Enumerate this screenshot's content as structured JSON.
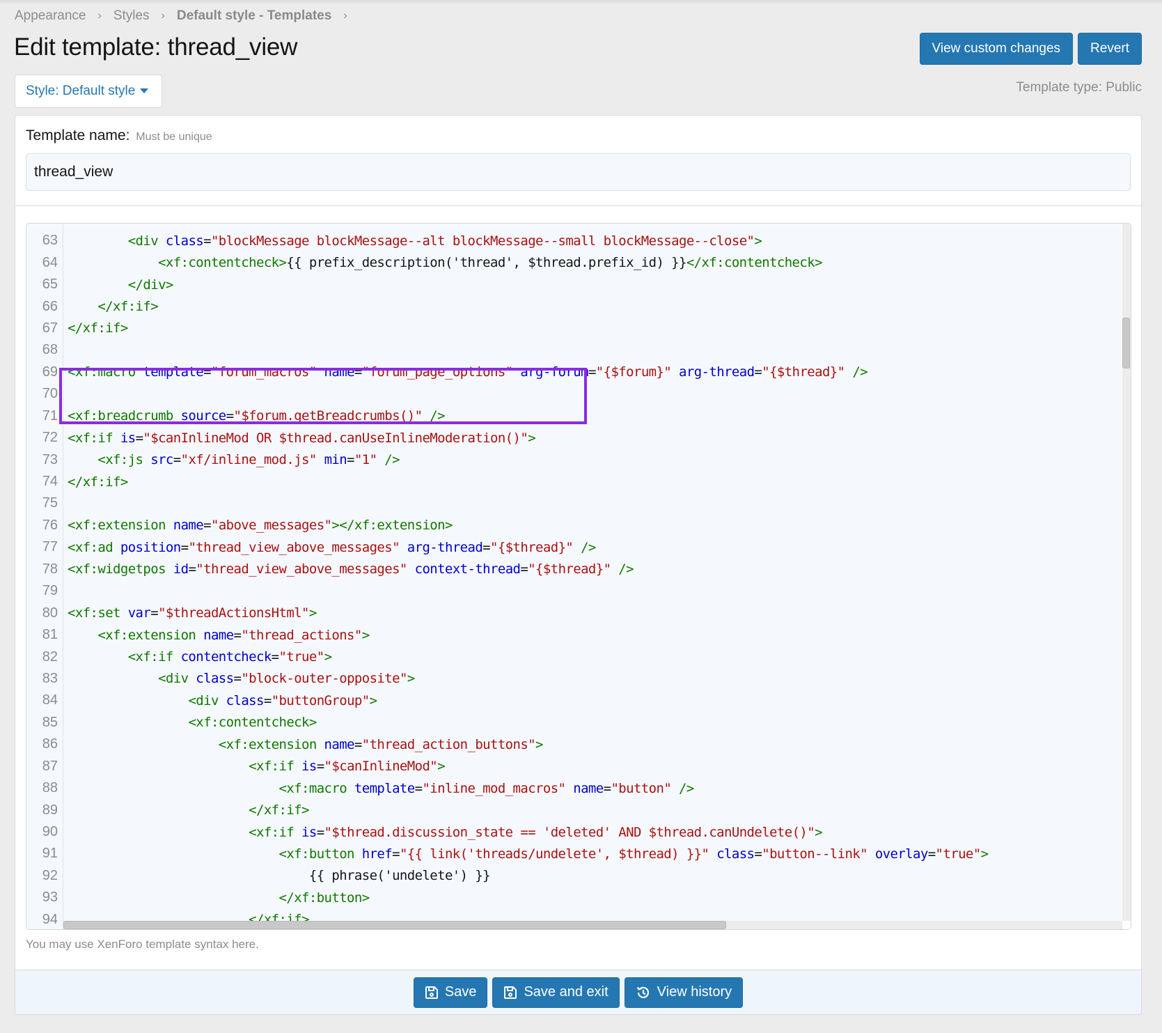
{
  "breadcrumb": {
    "items": [
      {
        "label": "Appearance"
      },
      {
        "label": "Styles"
      },
      {
        "label": "Default style - Templates"
      }
    ],
    "separator": "›"
  },
  "page": {
    "title": "Edit template: thread_view",
    "template_type": "Template type: Public"
  },
  "header_actions": {
    "view_custom_changes": "View custom changes",
    "revert": "Revert"
  },
  "style_chooser": {
    "label": "Style: Default style",
    "icon": "caret-down-icon"
  },
  "form": {
    "template_name_label": "Template name:",
    "template_name_hint": "Must be unique",
    "template_name_value": "thread_view",
    "syntax_hint": "You may use XenForo template syntax here."
  },
  "editor": {
    "highlight_color": "#8a2be2",
    "highlighted_lines": [
      70,
      71,
      72
    ],
    "vertical_scroll_position": 0.14,
    "horizontal_scroll_visible_fraction": 0.63,
    "lines": [
      {
        "n": "63",
        "indent": "        ",
        "tokens": [
          [
            "tag",
            "<div "
          ],
          [
            "attr",
            "class"
          ],
          [
            "eq",
            "="
          ],
          [
            "str",
            "\"blockMessage blockMessage--alt blockMessage--small blockMessage--close\""
          ],
          [
            "tag",
            ">"
          ]
        ]
      },
      {
        "n": "64",
        "indent": "            ",
        "tokens": [
          [
            "tag",
            "<xf:contentcheck>"
          ],
          [
            "txt",
            "{{ prefix_description('thread', $thread.prefix_id) }}"
          ],
          [
            "tag",
            "</xf:contentcheck>"
          ]
        ]
      },
      {
        "n": "65",
        "indent": "        ",
        "tokens": [
          [
            "tag",
            "</div>"
          ]
        ]
      },
      {
        "n": "66",
        "indent": "    ",
        "tokens": [
          [
            "tag",
            "</xf:if>"
          ]
        ]
      },
      {
        "n": "67",
        "indent": "",
        "tokens": [
          [
            "tag",
            "</xf:if>"
          ]
        ]
      },
      {
        "n": "68",
        "indent": "",
        "tokens": []
      },
      {
        "n": "69",
        "indent": "",
        "tokens": [
          [
            "tag",
            "<xf:macro "
          ],
          [
            "attr",
            "template"
          ],
          [
            "eq",
            "="
          ],
          [
            "str",
            "\"forum_macros\""
          ],
          [
            "txt",
            " "
          ],
          [
            "attr",
            "name"
          ],
          [
            "eq",
            "="
          ],
          [
            "str",
            "\"forum_page_options\""
          ],
          [
            "txt",
            " "
          ],
          [
            "attr",
            "arg-forum"
          ],
          [
            "eq",
            "="
          ],
          [
            "str",
            "\"{$forum}\""
          ],
          [
            "txt",
            " "
          ],
          [
            "attr",
            "arg-thread"
          ],
          [
            "eq",
            "="
          ],
          [
            "str",
            "\"{$thread}\""
          ],
          [
            "tag",
            " />"
          ]
        ]
      },
      {
        "n": "70",
        "indent": "",
        "tokens": []
      },
      {
        "n": "71",
        "indent": "",
        "tokens": [
          [
            "tag",
            "<xf:breadcrumb "
          ],
          [
            "attr",
            "source"
          ],
          [
            "eq",
            "="
          ],
          [
            "str",
            "\"$forum.getBreadcrumbs()\""
          ],
          [
            "tag",
            " />"
          ]
        ]
      },
      {
        "n": "72",
        "indent": "",
        "tokens": [
          [
            "tag",
            "<xf:if "
          ],
          [
            "attr",
            "is"
          ],
          [
            "eq",
            "="
          ],
          [
            "str",
            "\"$canInlineMod OR $thread.canUseInlineModeration()\""
          ],
          [
            "tag",
            ">"
          ]
        ]
      },
      {
        "n": "73",
        "indent": "    ",
        "tokens": [
          [
            "tag",
            "<xf:js "
          ],
          [
            "attr",
            "src"
          ],
          [
            "eq",
            "="
          ],
          [
            "str",
            "\"xf/inline_mod.js\""
          ],
          [
            "txt",
            " "
          ],
          [
            "attr",
            "min"
          ],
          [
            "eq",
            "="
          ],
          [
            "str",
            "\"1\""
          ],
          [
            "tag",
            " />"
          ]
        ]
      },
      {
        "n": "74",
        "indent": "",
        "tokens": [
          [
            "tag",
            "</xf:if>"
          ]
        ]
      },
      {
        "n": "75",
        "indent": "",
        "tokens": []
      },
      {
        "n": "76",
        "indent": "",
        "tokens": [
          [
            "tag",
            "<xf:extension "
          ],
          [
            "attr",
            "name"
          ],
          [
            "eq",
            "="
          ],
          [
            "str",
            "\"above_messages\""
          ],
          [
            "tag",
            "></xf:extension>"
          ]
        ]
      },
      {
        "n": "77",
        "indent": "",
        "tokens": [
          [
            "tag",
            "<xf:ad "
          ],
          [
            "attr",
            "position"
          ],
          [
            "eq",
            "="
          ],
          [
            "str",
            "\"thread_view_above_messages\""
          ],
          [
            "txt",
            " "
          ],
          [
            "attr",
            "arg-thread"
          ],
          [
            "eq",
            "="
          ],
          [
            "str",
            "\"{$thread}\""
          ],
          [
            "tag",
            " />"
          ]
        ]
      },
      {
        "n": "78",
        "indent": "",
        "tokens": [
          [
            "tag",
            "<xf:widgetpos "
          ],
          [
            "attr",
            "id"
          ],
          [
            "eq",
            "="
          ],
          [
            "str",
            "\"thread_view_above_messages\""
          ],
          [
            "txt",
            " "
          ],
          [
            "attr",
            "context-thread"
          ],
          [
            "eq",
            "="
          ],
          [
            "str",
            "\"{$thread}\""
          ],
          [
            "tag",
            " />"
          ]
        ]
      },
      {
        "n": "79",
        "indent": "",
        "tokens": []
      },
      {
        "n": "80",
        "indent": "",
        "tokens": [
          [
            "tag",
            "<xf:set "
          ],
          [
            "attr",
            "var"
          ],
          [
            "eq",
            "="
          ],
          [
            "str",
            "\"$threadActionsHtml\""
          ],
          [
            "tag",
            ">"
          ]
        ]
      },
      {
        "n": "81",
        "indent": "    ",
        "tokens": [
          [
            "tag",
            "<xf:extension "
          ],
          [
            "attr",
            "name"
          ],
          [
            "eq",
            "="
          ],
          [
            "str",
            "\"thread_actions\""
          ],
          [
            "tag",
            ">"
          ]
        ]
      },
      {
        "n": "82",
        "indent": "        ",
        "tokens": [
          [
            "tag",
            "<xf:if "
          ],
          [
            "attr",
            "contentcheck"
          ],
          [
            "eq",
            "="
          ],
          [
            "str",
            "\"true\""
          ],
          [
            "tag",
            ">"
          ]
        ]
      },
      {
        "n": "83",
        "indent": "            ",
        "tokens": [
          [
            "tag",
            "<div "
          ],
          [
            "attr",
            "class"
          ],
          [
            "eq",
            "="
          ],
          [
            "str",
            "\"block-outer-opposite\""
          ],
          [
            "tag",
            ">"
          ]
        ]
      },
      {
        "n": "84",
        "indent": "                ",
        "tokens": [
          [
            "tag",
            "<div "
          ],
          [
            "attr",
            "class"
          ],
          [
            "eq",
            "="
          ],
          [
            "str",
            "\"buttonGroup\""
          ],
          [
            "tag",
            ">"
          ]
        ]
      },
      {
        "n": "85",
        "indent": "                ",
        "tokens": [
          [
            "tag",
            "<xf:contentcheck>"
          ]
        ]
      },
      {
        "n": "86",
        "indent": "                    ",
        "tokens": [
          [
            "tag",
            "<xf:extension "
          ],
          [
            "attr",
            "name"
          ],
          [
            "eq",
            "="
          ],
          [
            "str",
            "\"thread_action_buttons\""
          ],
          [
            "tag",
            ">"
          ]
        ]
      },
      {
        "n": "87",
        "indent": "                        ",
        "tokens": [
          [
            "tag",
            "<xf:if "
          ],
          [
            "attr",
            "is"
          ],
          [
            "eq",
            "="
          ],
          [
            "str",
            "\"$canInlineMod\""
          ],
          [
            "tag",
            ">"
          ]
        ]
      },
      {
        "n": "88",
        "indent": "                            ",
        "tokens": [
          [
            "tag",
            "<xf:macro "
          ],
          [
            "attr",
            "template"
          ],
          [
            "eq",
            "="
          ],
          [
            "str",
            "\"inline_mod_macros\""
          ],
          [
            "txt",
            " "
          ],
          [
            "attr",
            "name"
          ],
          [
            "eq",
            "="
          ],
          [
            "str",
            "\"button\""
          ],
          [
            "tag",
            " />"
          ]
        ]
      },
      {
        "n": "89",
        "indent": "                        ",
        "tokens": [
          [
            "tag",
            "</xf:if>"
          ]
        ]
      },
      {
        "n": "90",
        "indent": "                        ",
        "tokens": [
          [
            "tag",
            "<xf:if "
          ],
          [
            "attr",
            "is"
          ],
          [
            "eq",
            "="
          ],
          [
            "str",
            "\"$thread.discussion_state == 'deleted' AND $thread.canUndelete()\""
          ],
          [
            "tag",
            ">"
          ]
        ]
      },
      {
        "n": "91",
        "indent": "                            ",
        "tokens": [
          [
            "tag",
            "<xf:button "
          ],
          [
            "attr",
            "href"
          ],
          [
            "eq",
            "="
          ],
          [
            "str",
            "\"{{ link('threads/undelete', $thread) }}\""
          ],
          [
            "txt",
            " "
          ],
          [
            "attr",
            "class"
          ],
          [
            "eq",
            "="
          ],
          [
            "str",
            "\"button--link\""
          ],
          [
            "txt",
            " "
          ],
          [
            "attr",
            "overlay"
          ],
          [
            "eq",
            "="
          ],
          [
            "str",
            "\"true\""
          ],
          [
            "tag",
            ">"
          ]
        ]
      },
      {
        "n": "92",
        "indent": "                                ",
        "tokens": [
          [
            "txt",
            "{{ phrase('undelete') }}"
          ]
        ]
      },
      {
        "n": "93",
        "indent": "                            ",
        "tokens": [
          [
            "tag",
            "</xf:button>"
          ]
        ]
      },
      {
        "n": "94",
        "indent": "                        ",
        "tokens": [
          [
            "tag",
            "</xf:if>"
          ]
        ]
      }
    ]
  },
  "footer": {
    "save": {
      "label": "Save",
      "icon": "save-icon"
    },
    "save_exit": {
      "label": "Save and exit",
      "icon": "save-icon"
    },
    "view_history": {
      "label": "View history",
      "icon": "history-icon"
    }
  },
  "colors": {
    "accent": "#2577b1",
    "tag": "#117700",
    "attribute": "#0000cc",
    "string": "#aa1111",
    "highlight": "#8a2be2"
  }
}
